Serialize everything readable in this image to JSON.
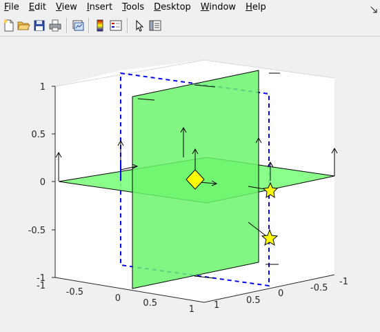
{
  "menu": {
    "items": [
      {
        "label": "File",
        "key": "F",
        "rest": "ile"
      },
      {
        "label": "Edit",
        "key": "E",
        "rest": "dit"
      },
      {
        "label": "View",
        "key": "V",
        "rest": "iew"
      },
      {
        "label": "Insert",
        "key": "I",
        "rest": "nsert"
      },
      {
        "label": "Tools",
        "key": "T",
        "rest": "ools"
      },
      {
        "label": "Desktop",
        "key": "D",
        "rest": "esktop"
      },
      {
        "label": "Window",
        "key": "W",
        "rest": "indow"
      },
      {
        "label": "Help",
        "key": "H",
        "rest": "elp"
      }
    ]
  },
  "toolbar": {
    "buttons": [
      {
        "name": "new-figure",
        "icon": "new-file-icon"
      },
      {
        "name": "open-file",
        "icon": "folder-open-icon"
      },
      {
        "name": "save",
        "icon": "floppy-disk-icon"
      },
      {
        "name": "print",
        "icon": "printer-icon"
      },
      {
        "name": "link-plot",
        "icon": "link-plot-icon"
      },
      {
        "name": "insert-colorbar",
        "icon": "colorbar-icon"
      },
      {
        "name": "insert-legend",
        "icon": "legend-icon"
      },
      {
        "name": "edit-plot",
        "icon": "arrow-cursor-icon"
      },
      {
        "name": "show-plot-tools",
        "icon": "plot-tools-icon"
      }
    ]
  },
  "axes": {
    "z_ticks": [
      "1",
      "0.5",
      "0",
      "-0.5",
      "-1"
    ],
    "x_ticks": [
      "-1",
      "-0.5",
      "0",
      "0.5",
      "1"
    ],
    "y_ticks": [
      "-1",
      "-0.5",
      "0",
      "0.5",
      "1"
    ],
    "colors": {
      "plane": "#80ff80",
      "plane_edge": "#000000",
      "dashed_box": "#0000ff",
      "marker_fill": "#ffff00"
    },
    "markers": [
      "diamond",
      "pentagram",
      "pentagram"
    ]
  }
}
